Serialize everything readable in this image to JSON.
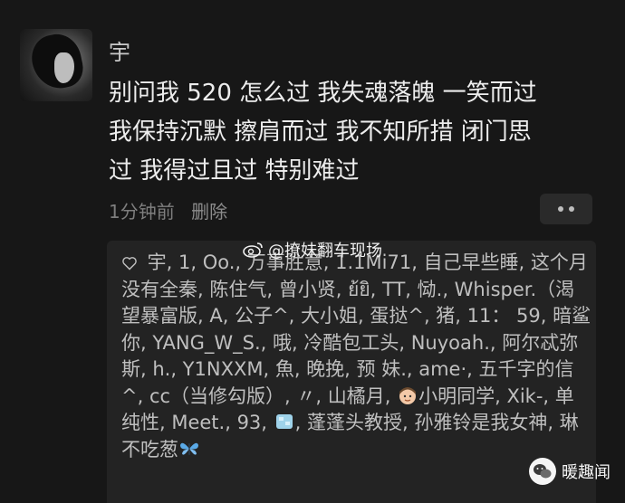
{
  "post": {
    "username": "宇",
    "content": "别问我 520 怎么过 我失魂落魄 一笑而过\n我保持沉默 擦肩而过 我不知所措 闭门思\n过 我得过且过 特别难过",
    "time": "1分钟前",
    "delete_label": "删除"
  },
  "likes": {
    "names_before_emoji1": " 宇, 1, Oo., 万事胜意, 1.1Mi71, 自己早些睡, 这个月没有全秦, 陈住气, 曾小贤, ย้ยิ, TT, 恸., Whisper.（渴望暴富版, A, 公子^, 大小姐, 蛋挞^, 猪, 11： 59, 暗鲨你, YANG_W_S., 哦, 冷酷包工头, Nuyoah., 阿尔忒弥斯, h., Y1NXXM, 魚, 晚挽, 预 妹., ame·, 五千字的信^, cc（当修勾版）, 〃, 山橘月, ",
    "names_before_emoji2": "小明同学, Xik-, 单纯性, Meet., 93, ",
    "names_before_emoji3": ", 蓬蓬头教授, 孙雅铃是我女神, 琳不吃葱",
    "icons": [
      "heart-icon",
      "boy-emoji-icon",
      "ice-cube-emoji-icon",
      "butterfly-emoji-icon"
    ]
  },
  "watermark": {
    "text": "@撩妹翻车现场",
    "icon": "weibo-icon"
  },
  "brand": {
    "text": "暖趣闻",
    "icon": "wechat-logo-icon"
  },
  "colors": {
    "background": "#171717",
    "panel": "#232323",
    "text": "#ededed",
    "muted": "#7e7e7e"
  }
}
